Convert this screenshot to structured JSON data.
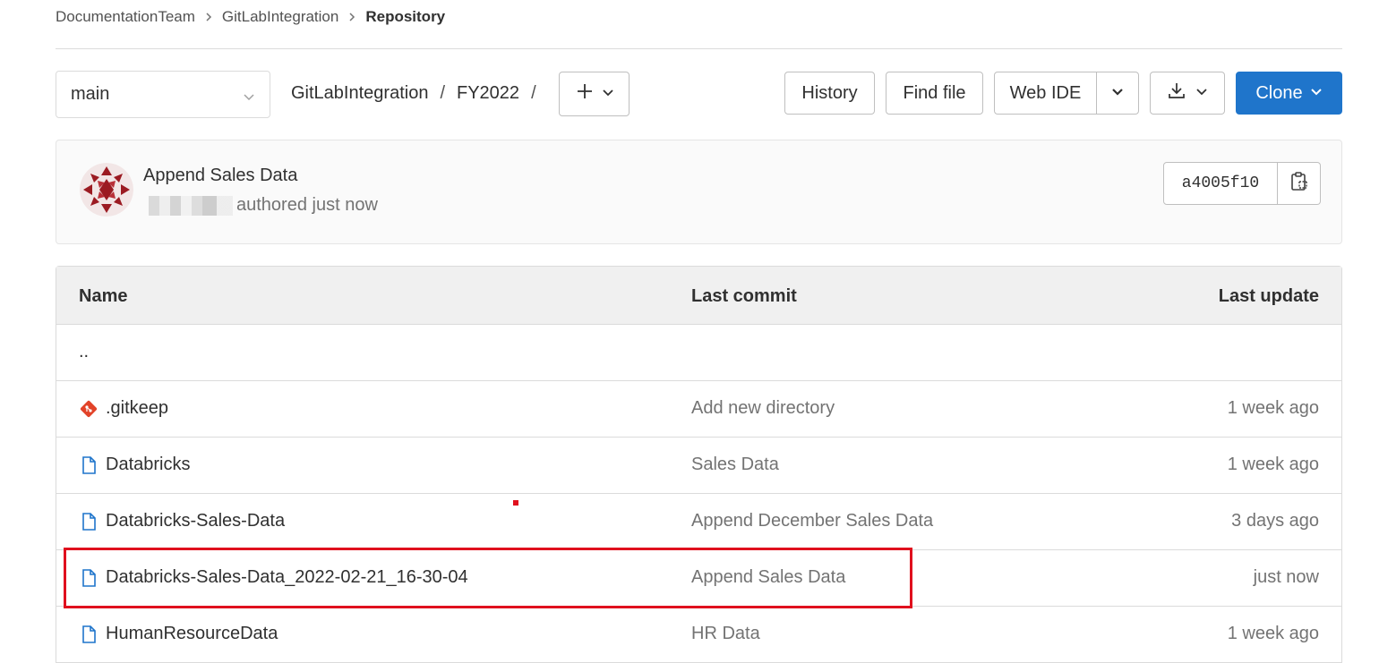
{
  "breadcrumb": {
    "items": [
      "DocumentationTeam",
      "GitLabIntegration"
    ],
    "current": "Repository"
  },
  "branch": {
    "selected": "main"
  },
  "path": {
    "segments": [
      "GitLabIntegration",
      "FY2022"
    ],
    "separator": "/"
  },
  "toolbar": {
    "history_label": "History",
    "findfile_label": "Find file",
    "webide_label": "Web IDE",
    "clone_label": "Clone"
  },
  "last_commit": {
    "title": "Append Sales Data",
    "meta": "authored just now",
    "sha": "a4005f10"
  },
  "table": {
    "headers": {
      "name": "Name",
      "commit": "Last commit",
      "update": "Last update"
    },
    "parent": "..",
    "rows": [
      {
        "name": ".gitkeep",
        "icon": "git-file-icon",
        "commit": "Add new directory",
        "updated": "1 week ago"
      },
      {
        "name": "Databricks",
        "icon": "file-icon",
        "commit": "Sales Data",
        "updated": "1 week ago"
      },
      {
        "name": "Databricks-Sales-Data",
        "icon": "file-icon",
        "commit": "Append December Sales Data",
        "updated": "3 days ago"
      },
      {
        "name": "Databricks-Sales-Data_2022-02-21_16-30-04",
        "icon": "file-icon",
        "commit": "Append Sales Data",
        "updated": "just now"
      },
      {
        "name": "HumanResourceData",
        "icon": "file-icon",
        "commit": "HR Data",
        "updated": "1 week ago"
      }
    ]
  },
  "colors": {
    "accent": "#1f75cb",
    "highlight": "#e0101e",
    "git_icon": "#e24329",
    "file_icon": "#1f75cb"
  }
}
